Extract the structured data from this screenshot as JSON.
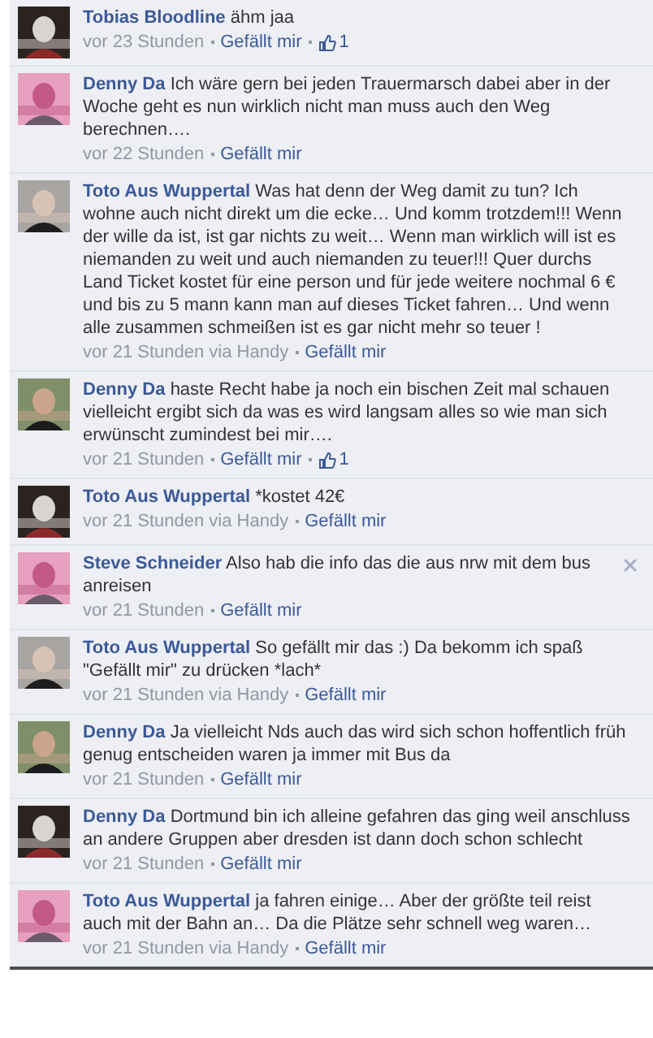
{
  "comments": [
    {
      "author": "Tobias Bloodline",
      "text": "ähm jaa",
      "time": "vor 23 Stunden",
      "like": "Gefällt mir",
      "likes": "1",
      "removable": false
    },
    {
      "author": "Denny Da",
      "text": "Ich wäre gern bei jeden Trauermarsch dabei aber in der Woche geht es nun wirklich nicht man muss auch den Weg berechnen….",
      "time": "vor 22 Stunden",
      "like": "Gefällt mir",
      "removable": false
    },
    {
      "author": "Toto Aus Wuppertal",
      "text": "Was hat denn der Weg damit zu tun? Ich wohne auch nicht direkt um die ecke… Und komm trotzdem!!! Wenn der wille da ist, ist gar nichts zu weit… Wenn man wirklich will ist es niemanden zu weit und auch niemanden zu teuer!!! Quer durchs Land Ticket kostet für eine person und für jede weitere nochmal 6 € und bis zu 5 mann kann man auf dieses Ticket fahren… Und wenn alle zusammen schmeißen ist es gar nicht mehr so teuer !",
      "time": "vor 21 Stunden via Handy",
      "like": "Gefällt mir",
      "removable": false
    },
    {
      "author": "Denny Da",
      "text": "haste Recht habe ja noch ein bischen Zeit mal schauen vielleicht ergibt sich da was es wird langsam alles so wie man sich erwünscht zumindest bei mir….",
      "time": "vor 21 Stunden",
      "like": "Gefällt mir",
      "likes": "1",
      "removable": false
    },
    {
      "author": "Toto Aus Wuppertal",
      "text": "*kostet 42€",
      "time": "vor 21 Stunden via Handy",
      "like": "Gefällt mir",
      "removable": false
    },
    {
      "author": "Steve Schneider",
      "text": "Also hab die info das die aus nrw mit dem bus anreisen",
      "time": "vor 21 Stunden",
      "like": "Gefällt mir",
      "removable": true
    },
    {
      "author": "Toto Aus Wuppertal",
      "text": "So gefällt mir das :) Da bekomm ich spaß \"Gefällt mir\" zu drücken *lach*",
      "time": "vor 21 Stunden via Handy",
      "like": "Gefällt mir",
      "removable": false
    },
    {
      "author": "Denny Da",
      "text": "Ja vielleicht Nds auch das wird sich schon hoffentlich früh genug entscheiden waren ja immer mit Bus da",
      "time": "vor 21 Stunden",
      "like": "Gefällt mir",
      "removable": false
    },
    {
      "author": "Denny Da",
      "text": "Dortmund bin ich alleine gefahren das ging weil anschluss an andere Gruppen aber dresden ist dann doch schon schlecht",
      "time": "vor 21 Stunden",
      "like": "Gefällt mir",
      "removable": false
    },
    {
      "author": "Toto Aus Wuppertal",
      "text": "ja fahren einige… Aber der größte teil reist auch mit der Bahn an… Da die Plätze sehr schnell weg waren…",
      "time": "vor 21 Stunden via Handy",
      "like": "Gefällt mir",
      "removable": false
    }
  ]
}
